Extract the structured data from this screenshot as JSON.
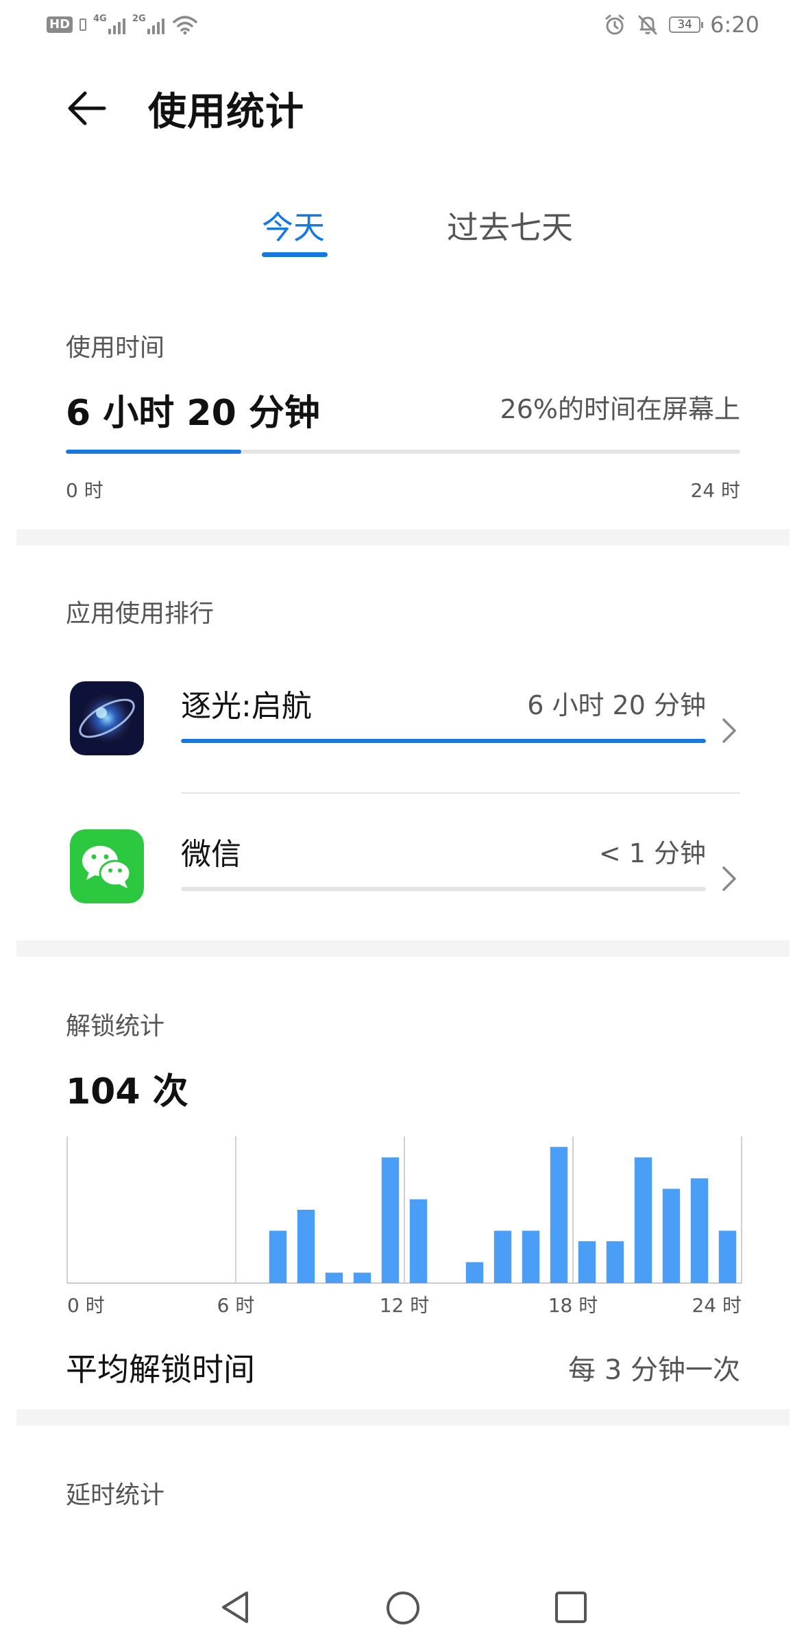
{
  "status_bar": {
    "hd": "HD",
    "net1": "4G",
    "net2": "2G",
    "battery": "34",
    "time": "6:20"
  },
  "header": {
    "title": "使用统计"
  },
  "tabs": [
    {
      "label": "今天",
      "active": true
    },
    {
      "label": "过去七天",
      "active": false
    }
  ],
  "usage": {
    "label": "使用时间",
    "value": "6 小时 20 分钟",
    "percent_text": "26%的时间在屏幕上",
    "progress": 0.26,
    "axis_start": "0 时",
    "axis_end": "24 时"
  },
  "ranking": {
    "label": "应用使用排行",
    "apps": [
      {
        "name": "逐光:启航",
        "time": "6 小时 20 分钟",
        "fraction": 1.0,
        "icon": "game-icon"
      },
      {
        "name": "微信",
        "time": "< 1 分钟",
        "fraction": 0.0,
        "icon": "wechat-icon"
      }
    ]
  },
  "unlock": {
    "label": "解锁统计",
    "count": "104 次",
    "avg_label": "平均解锁时间",
    "avg_value": "每 3 分钟一次"
  },
  "chart_data": {
    "type": "bar",
    "x": [
      0,
      1,
      2,
      3,
      4,
      5,
      6,
      7,
      8,
      9,
      10,
      11,
      12,
      13,
      14,
      15,
      16,
      17,
      18,
      19,
      20,
      21,
      22,
      23
    ],
    "values": [
      0,
      0,
      0,
      0,
      0,
      0,
      0,
      5,
      7,
      1,
      1,
      12,
      8,
      0,
      2,
      5,
      5,
      13,
      4,
      4,
      12,
      9,
      10,
      5,
      1
    ],
    "xlim": [
      0,
      24
    ],
    "ylim": [
      0,
      14
    ],
    "tick_values": [
      0,
      6,
      12,
      18,
      24
    ],
    "tick_labels": [
      "0 时",
      "6 时",
      "12 时",
      "18 时",
      "24 时"
    ],
    "color": "#4a9ef5"
  },
  "delay": {
    "label": "延时统计"
  },
  "colors": {
    "accent": "#1478e0",
    "bar": "#4a9ef5",
    "wechat": "#2bc840"
  }
}
